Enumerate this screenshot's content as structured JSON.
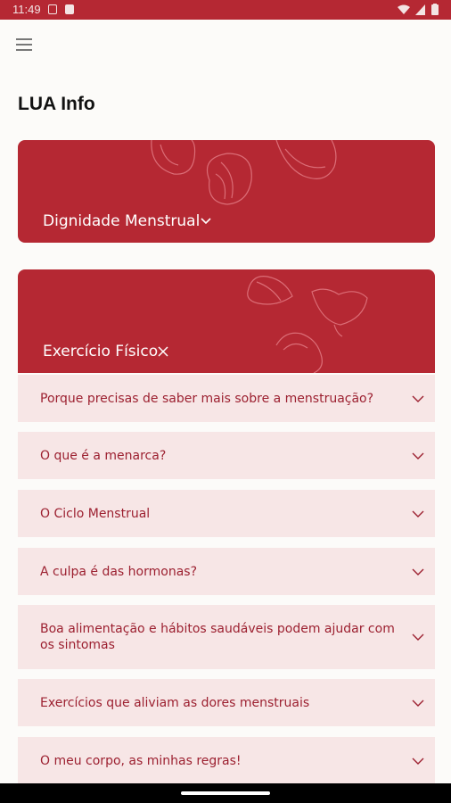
{
  "status_bar": {
    "time": "11:49"
  },
  "page": {
    "title": "LUA Info"
  },
  "categories": [
    {
      "label": "Dignidade Menstrual",
      "state_icon": "chevron-down-icon"
    },
    {
      "label": "Exercício Físico",
      "state_icon": "close-icon"
    }
  ],
  "faq": [
    {
      "question": "Porque precisas de saber mais sobre a menstruação?"
    },
    {
      "question": "O que é a menarca?"
    },
    {
      "question": "O Ciclo Menstrual"
    },
    {
      "question": "A culpa é das hormonas?"
    },
    {
      "question": "Boa alimentação e hábitos saudáveis podem ajudar com os sintomas"
    },
    {
      "question": "Exercícios que aliviam as dores menstruais"
    },
    {
      "question": "O meu corpo, as minhas regras!"
    }
  ],
  "colors": {
    "accent": "#b52833",
    "faq_bg": "#f7e6e6",
    "faq_text": "#9c2030"
  }
}
